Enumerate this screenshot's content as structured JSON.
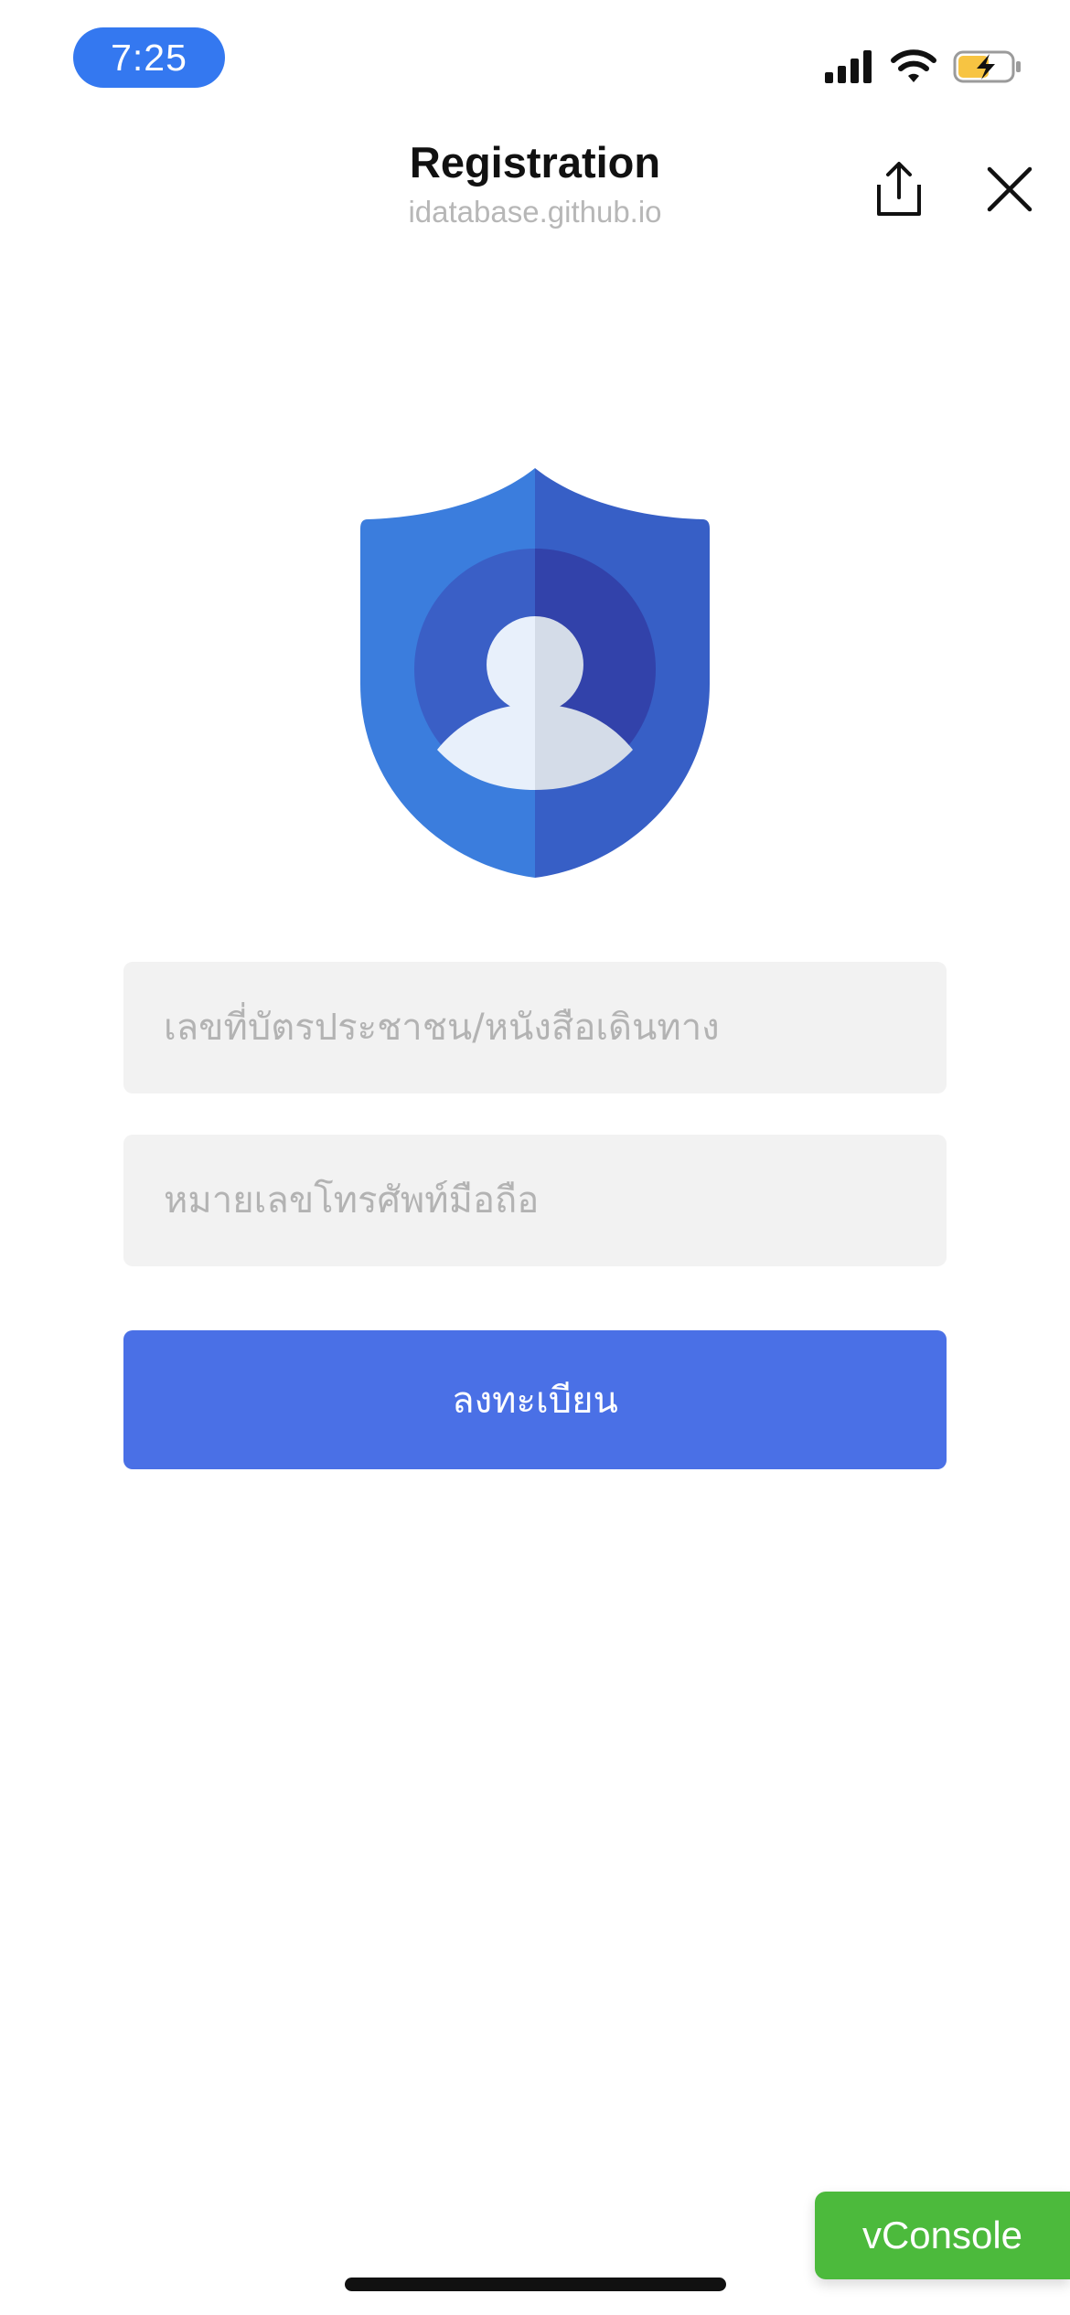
{
  "status_bar": {
    "time": "7:25",
    "icons": [
      "cellular-signal-icon",
      "wifi-icon",
      "battery-charging-icon"
    ]
  },
  "nav": {
    "title": "Registration",
    "subtitle": "idatabase.github.io",
    "share_icon": "share-icon",
    "close_icon": "close-icon"
  },
  "logo": {
    "icon": "shield-user-icon",
    "colors": {
      "shield_left": "#3b7ddd",
      "shield_right": "#375fc6",
      "circle_left": "#3a5fc6",
      "circle_right": "#3242aa",
      "person_left": "#e8f0fb",
      "person_right": "#d4dce8"
    }
  },
  "form": {
    "id_field": {
      "placeholder": "เลขที่บัตรประชาชน/หนังสือเดินทาง",
      "value": ""
    },
    "phone_field": {
      "placeholder": "หมายเลขโทรศัพท์มือถือ",
      "value": ""
    },
    "submit_label": "ลงทะเบียน"
  },
  "vconsole": {
    "label": "vConsole"
  },
  "colors": {
    "primary": "#4a70e6",
    "time_pill": "#3478f0",
    "vconsole": "#4cba3c",
    "input_bg": "#f2f2f2",
    "placeholder": "#b3b3b3",
    "battery_fill": "#f7c442"
  }
}
